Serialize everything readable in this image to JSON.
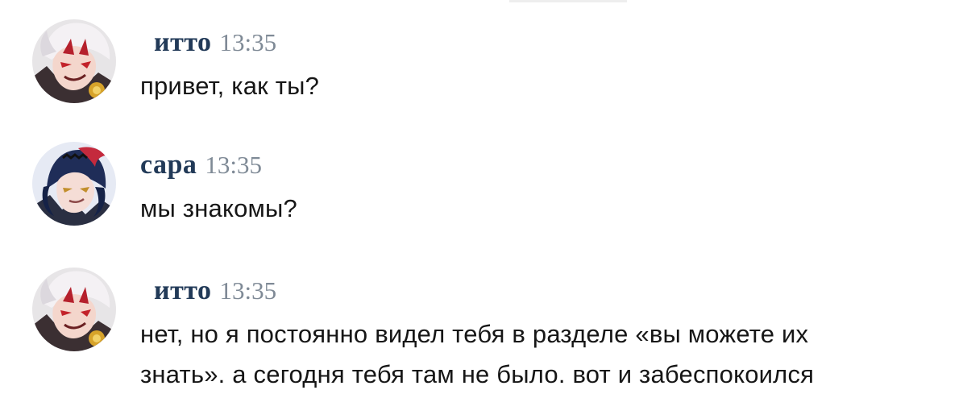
{
  "messages": [
    {
      "author": "итто",
      "time": "13:35",
      "avatar": "itto-avatar",
      "lines": [
        "привет, как ты?"
      ]
    },
    {
      "author": "сара",
      "time": "13:35",
      "avatar": "sara-avatar",
      "lines": [
        "мы знакомы?"
      ]
    },
    {
      "author": "итто",
      "time": "13:35",
      "avatar": "itto-avatar",
      "lines": [
        "нет, но я постоянно видел тебя в разделе «вы можете их",
        "знать». а сегодня тебя там не было. вот и забеспокоился"
      ]
    }
  ],
  "colors": {
    "author": "#223a58",
    "time": "#7f8a96",
    "text": "#161616",
    "background": "#ffffff"
  }
}
